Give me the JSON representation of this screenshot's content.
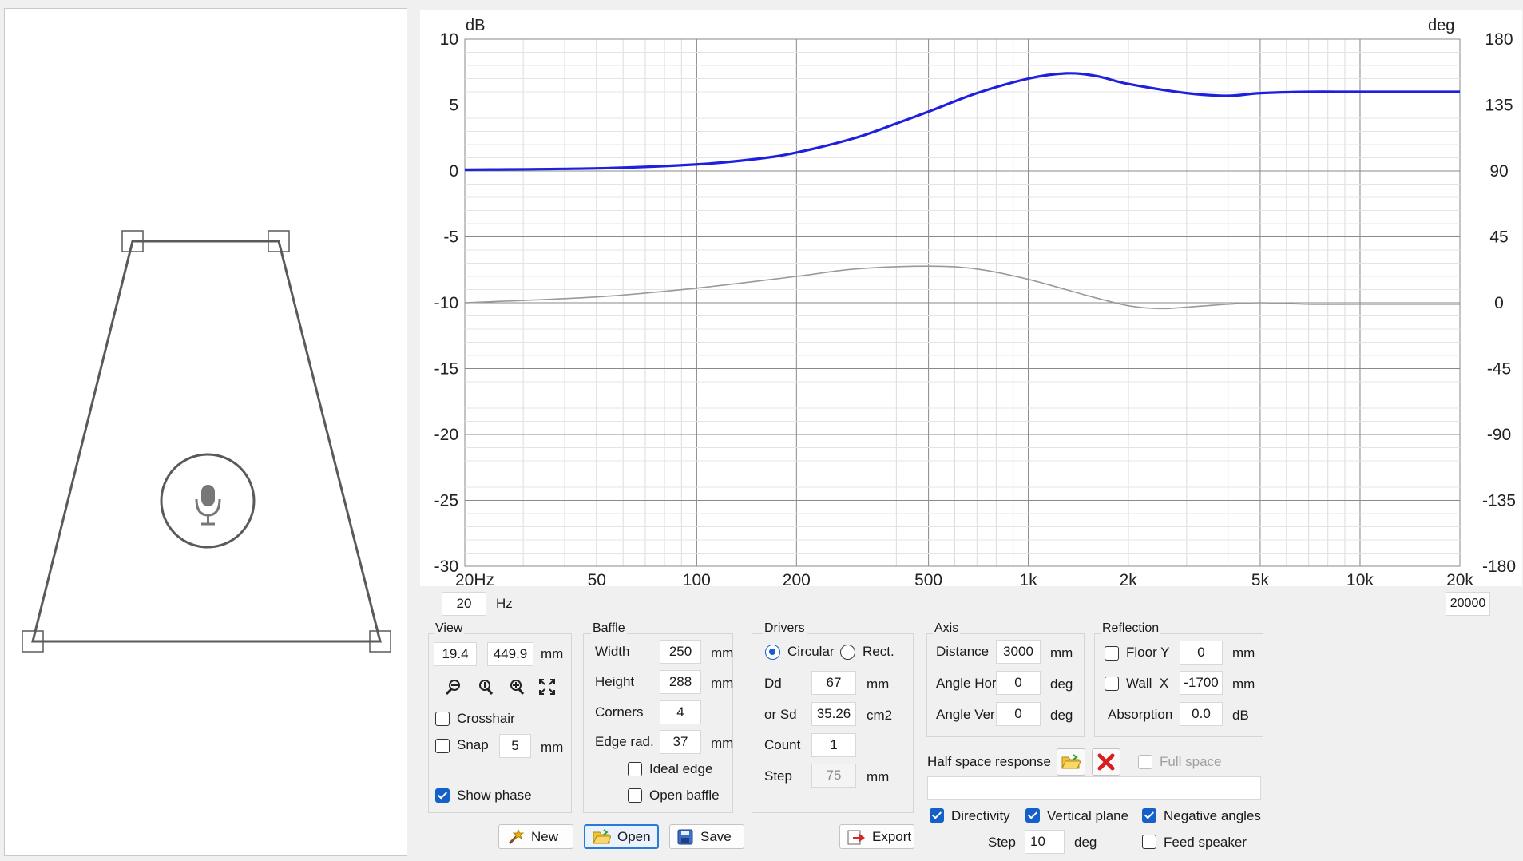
{
  "chart_data": {
    "type": "line",
    "x_scale": "log",
    "xlim": [
      20,
      20000
    ],
    "x_tick_labels": [
      "20Hz",
      "50",
      "100",
      "200",
      "500",
      "1k",
      "2k",
      "5k",
      "10k",
      "20k"
    ],
    "x_tick_values": [
      20,
      50,
      100,
      200,
      500,
      1000,
      2000,
      5000,
      10000,
      20000
    ],
    "ylabel": "dB",
    "ylim": [
      -30,
      10
    ],
    "y_ticks": [
      10,
      5,
      0,
      -5,
      -10,
      -15,
      -20,
      -25,
      -30
    ],
    "y2label": "deg",
    "y2lim": [
      -180,
      180
    ],
    "y2_ticks": [
      180,
      135,
      90,
      45,
      0,
      -45,
      -90,
      -135,
      -180
    ],
    "grid": true,
    "series": [
      {
        "axis": "left",
        "color": "#1f1fe0",
        "points": [
          [
            20,
            0.1
          ],
          [
            50,
            0.2
          ],
          [
            100,
            0.5
          ],
          [
            150,
            0.9
          ],
          [
            200,
            1.4
          ],
          [
            300,
            2.5
          ],
          [
            400,
            3.6
          ],
          [
            500,
            4.5
          ],
          [
            700,
            5.9
          ],
          [
            1000,
            7.0
          ],
          [
            1300,
            7.4
          ],
          [
            1600,
            7.2
          ],
          [
            2000,
            6.6
          ],
          [
            3000,
            5.9
          ],
          [
            4000,
            5.7
          ],
          [
            5000,
            5.9
          ],
          [
            7000,
            6.0
          ],
          [
            10000,
            6.0
          ],
          [
            20000,
            6.0
          ]
        ]
      },
      {
        "axis": "right",
        "color": "#9a9a9a",
        "points": [
          [
            20,
            0
          ],
          [
            50,
            4
          ],
          [
            100,
            10
          ],
          [
            200,
            18
          ],
          [
            300,
            23
          ],
          [
            500,
            25
          ],
          [
            700,
            23
          ],
          [
            1000,
            16
          ],
          [
            1500,
            5
          ],
          [
            2000,
            -2
          ],
          [
            2500,
            -4
          ],
          [
            3000,
            -3
          ],
          [
            4000,
            -1
          ],
          [
            5000,
            0
          ],
          [
            7000,
            -1
          ],
          [
            10000,
            -1
          ],
          [
            20000,
            -1
          ]
        ]
      }
    ]
  },
  "colors": {
    "magnitude": "#1f1fe0",
    "phase": "#9a9a9a",
    "accent": "#1460c8",
    "delete": "#d81e1e"
  },
  "freq": {
    "low": "20",
    "low_unit": "Hz",
    "high": "20000"
  },
  "view": {
    "label": "View",
    "x": "19.4",
    "y": "449.9",
    "unit": "mm",
    "crosshair": "Crosshair",
    "crosshair_checked": false,
    "snap": "Snap",
    "snap_checked": false,
    "snap_value": "5",
    "snap_unit": "mm",
    "show_phase": "Show phase",
    "show_phase_checked": true
  },
  "baffle": {
    "label": "Baffle",
    "width_label": "Width",
    "width": "250",
    "width_unit": "mm",
    "height_label": "Height",
    "height": "288",
    "height_unit": "mm",
    "corners_label": "Corners",
    "corners": "4",
    "edge_label": "Edge rad.",
    "edge": "37",
    "edge_unit": "mm",
    "ideal_edge": "Ideal edge",
    "open_baffle": "Open baffle"
  },
  "drivers": {
    "label": "Drivers",
    "circular": "Circular",
    "rect": "Rect.",
    "dd_label": "Dd",
    "dd": "67",
    "dd_unit": "mm",
    "sd_label": "or Sd",
    "sd": "35.26",
    "sd_unit": "cm2",
    "count_label": "Count",
    "count": "1",
    "step_label": "Step",
    "step": "75",
    "step_unit": "mm"
  },
  "axis": {
    "label": "Axis",
    "distance_label": "Distance",
    "distance": "3000",
    "distance_unit": "mm",
    "hor_label": "Angle Hor",
    "hor": "0",
    "hor_unit": "deg",
    "ver_label": "Angle Ver",
    "ver": "0",
    "ver_unit": "deg"
  },
  "reflection": {
    "label": "Reflection",
    "floor_label": "Floor Y",
    "floor": "0",
    "floor_unit": "mm",
    "wall_label": "Wall  X",
    "wall": "-1700",
    "wall_unit": "mm",
    "absorption_label": "Absorption",
    "absorption": "0.0",
    "absorption_unit": "dB"
  },
  "half_space": {
    "label": "Half space response",
    "full_space": "Full space",
    "path": ""
  },
  "directivity": {
    "directivity": "Directivity",
    "vertical_plane": "Vertical plane",
    "negative_angles": "Negative angles",
    "step_label": "Step",
    "step": "10",
    "step_unit": "deg",
    "feed_speaker": "Feed speaker"
  },
  "buttons": {
    "new": "New",
    "open": "Open",
    "save": "Save",
    "export": "Export"
  },
  "icons": {
    "zoom_out": "zoom-out-icon",
    "zoom_in_y": "zoom-y-icon",
    "zoom_in": "zoom-in-icon",
    "fit": "fit-icon",
    "mic": "microphone-icon",
    "folder": "folder-icon",
    "delete": "delete-icon"
  }
}
